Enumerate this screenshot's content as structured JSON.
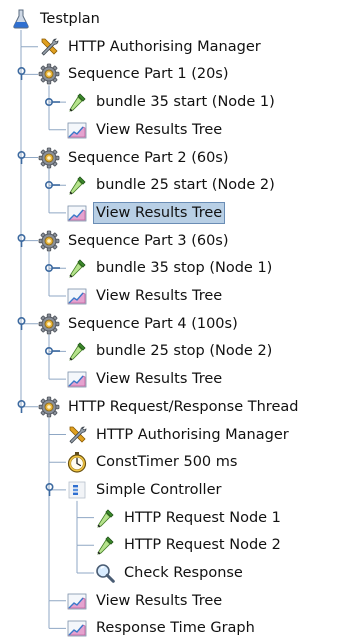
{
  "tree": {
    "nodes": [
      {
        "label": "Testplan",
        "icon": "flask-icon",
        "depth": 0,
        "toggle": "none"
      },
      {
        "label": "HTTP Authorising Manager",
        "icon": "tools-icon",
        "depth": 1,
        "toggle": "none"
      },
      {
        "label": "Sequence Part 1 (20s)",
        "icon": "gear-icon",
        "depth": 1,
        "toggle": "expanded"
      },
      {
        "label": "bundle 35 start (Node 1)",
        "icon": "pipette-icon",
        "depth": 2,
        "toggle": "collapsed"
      },
      {
        "label": "View Results Tree",
        "icon": "graph-icon",
        "depth": 2,
        "toggle": "none"
      },
      {
        "label": "Sequence Part 2 (60s)",
        "icon": "gear-icon",
        "depth": 1,
        "toggle": "expanded"
      },
      {
        "label": "bundle 25 start (Node 2)",
        "icon": "pipette-icon",
        "depth": 2,
        "toggle": "collapsed"
      },
      {
        "label": "View Results Tree",
        "icon": "graph-icon",
        "depth": 2,
        "toggle": "none",
        "selected": true
      },
      {
        "label": "Sequence Part 3 (60s)",
        "icon": "gear-icon",
        "depth": 1,
        "toggle": "expanded"
      },
      {
        "label": "bundle 35 stop (Node 1)",
        "icon": "pipette-icon",
        "depth": 2,
        "toggle": "collapsed"
      },
      {
        "label": "View Results Tree",
        "icon": "graph-icon",
        "depth": 2,
        "toggle": "none"
      },
      {
        "label": "Sequence Part 4 (100s)",
        "icon": "gear-icon",
        "depth": 1,
        "toggle": "expanded"
      },
      {
        "label": "bundle 25 stop (Node 2)",
        "icon": "pipette-icon",
        "depth": 2,
        "toggle": "collapsed"
      },
      {
        "label": "View Results Tree",
        "icon": "graph-icon",
        "depth": 2,
        "toggle": "none"
      },
      {
        "label": "HTTP Request/Response Thread",
        "icon": "gear-icon",
        "depth": 1,
        "toggle": "expanded"
      },
      {
        "label": "HTTP Authorising Manager",
        "icon": "tools-icon",
        "depth": 2,
        "toggle": "none"
      },
      {
        "label": "ConstTimer 500 ms",
        "icon": "stopwatch-icon",
        "depth": 2,
        "toggle": "none"
      },
      {
        "label": "Simple Controller",
        "icon": "controller-icon",
        "depth": 2,
        "toggle": "expanded"
      },
      {
        "label": "HTTP Request Node 1",
        "icon": "pipette-icon",
        "depth": 3,
        "toggle": "none"
      },
      {
        "label": "HTTP Request Node 2",
        "icon": "pipette-icon",
        "depth": 3,
        "toggle": "none"
      },
      {
        "label": "Check Response",
        "icon": "magnifier-icon",
        "depth": 3,
        "toggle": "none"
      },
      {
        "label": "View Results Tree",
        "icon": "graph-icon",
        "depth": 2,
        "toggle": "none"
      },
      {
        "label": "Response Time Graph",
        "icon": "graph-icon",
        "depth": 2,
        "toggle": "none"
      }
    ]
  },
  "colors": {
    "selection_bg": "#b8cfe5",
    "selection_border": "#6a8db5",
    "tree_line": "#8fa7c4",
    "toggle": "#3d6aa0"
  }
}
